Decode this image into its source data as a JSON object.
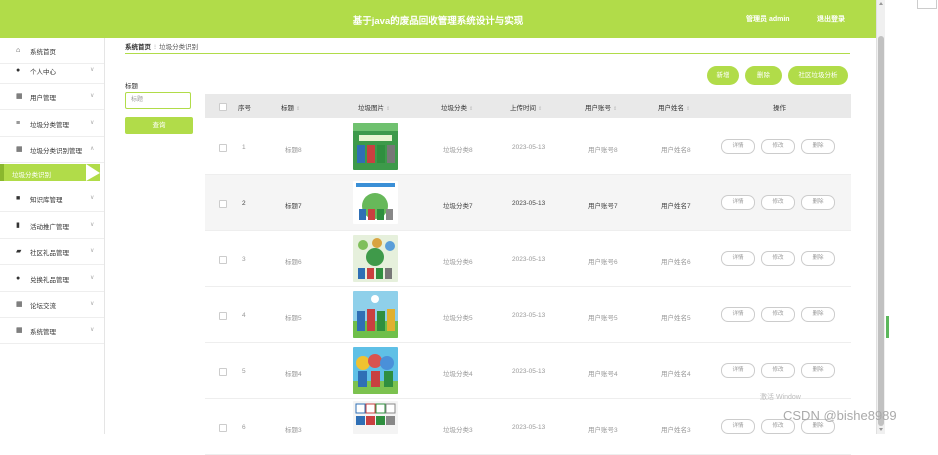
{
  "header": {
    "title": "基于java的废品回收管理系统设计与实现",
    "admin": "管理员 admin",
    "logout": "退出登录"
  },
  "sidebar": {
    "items": [
      {
        "icon": "⌂",
        "label": "系统首页",
        "chev": ""
      },
      {
        "icon": "●",
        "label": "个人中心",
        "chev": "∨"
      },
      {
        "icon": "▦",
        "label": "用户管理",
        "chev": "∨"
      },
      {
        "icon": "≡",
        "label": "垃圾分类管理",
        "chev": "∨"
      },
      {
        "icon": "▦",
        "label": "垃圾分类识别管理",
        "chev": "∧"
      },
      {
        "icon": "■",
        "label": "知识库管理",
        "chev": "∨"
      },
      {
        "icon": "▮",
        "label": "活动推广管理",
        "chev": "∨"
      },
      {
        "icon": "▰",
        "label": "社区礼品管理",
        "chev": "∨"
      },
      {
        "icon": "●",
        "label": "兑换礼品管理",
        "chev": "∨"
      },
      {
        "icon": "▦",
        "label": "论坛交流",
        "chev": "∨"
      },
      {
        "icon": "▦",
        "label": "系统管理",
        "chev": "∨"
      }
    ],
    "sub_item": "垃圾分类识别"
  },
  "breadcrumb": {
    "home": "系统首页",
    "sep": "⁝",
    "current": "垃圾分类识别"
  },
  "search": {
    "label": "标题",
    "placeholder": "标题",
    "button": "查询"
  },
  "buttons": {
    "add": "新增",
    "delete": "删除",
    "analysis": "社区垃圾分析"
  },
  "table": {
    "headers": [
      "序号",
      "标题",
      "垃圾图片",
      "垃圾分类",
      "上传时间",
      "用户账号",
      "用户姓名",
      "操作"
    ],
    "sort_glyph": "⇕",
    "actions": [
      "详情",
      "修改",
      "删除"
    ],
    "rows": [
      {
        "no": "1",
        "title": "标题8",
        "category": "垃圾分类8",
        "time": "2023-05-13",
        "account": "用户账号8",
        "name": "用户姓名8"
      },
      {
        "no": "2",
        "title": "标题7",
        "category": "垃圾分类7",
        "time": "2023-05-13",
        "account": "用户账号7",
        "name": "用户姓名7"
      },
      {
        "no": "3",
        "title": "标题6",
        "category": "垃圾分类6",
        "time": "2023-05-13",
        "account": "用户账号6",
        "name": "用户姓名6"
      },
      {
        "no": "4",
        "title": "标题5",
        "category": "垃圾分类5",
        "time": "2023-05-13",
        "account": "用户账号5",
        "name": "用户姓名5"
      },
      {
        "no": "5",
        "title": "标题4",
        "category": "垃圾分类4",
        "time": "2023-05-13",
        "account": "用户账号4",
        "name": "用户姓名4"
      },
      {
        "no": "6",
        "title": "标题3",
        "category": "垃圾分类3",
        "time": "2023-05-13",
        "account": "用户账号3",
        "name": "用户姓名3"
      }
    ]
  },
  "overlay": {
    "watermark": "激活 Window",
    "csdn": "CSDN @bishe8989"
  },
  "colors": {
    "accent": "#b1dc49"
  }
}
